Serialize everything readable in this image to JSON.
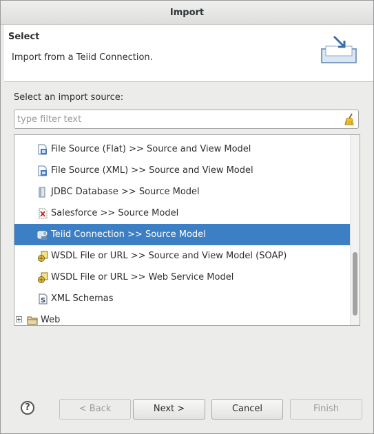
{
  "dialog": {
    "title": "Import"
  },
  "header": {
    "title": "Select",
    "description": "Import from a Teiid Connection."
  },
  "source": {
    "label": "Select an import source:",
    "filter_placeholder": "type filter text",
    "filter_value": ""
  },
  "tree": {
    "items": [
      {
        "label": "File Source (Flat) >> Source and View Model",
        "icon": "file-source-icon",
        "selected": false
      },
      {
        "label": "File Source (XML) >> Source and View Model",
        "icon": "file-source-xml-icon",
        "selected": false
      },
      {
        "label": "JDBC Database >> Source Model",
        "icon": "database-icon",
        "selected": false
      },
      {
        "label": "Salesforce >> Source Model",
        "icon": "salesforce-icon",
        "selected": false
      },
      {
        "label": "Teiid Connection >> Source Model",
        "icon": "teiid-connection-icon",
        "selected": true
      },
      {
        "label": "WSDL File or URL >> Source and View Model (SOAP)",
        "icon": "wsdl-icon",
        "selected": false
      },
      {
        "label": "WSDL File or URL >> Web Service Model",
        "icon": "wsdl-icon",
        "selected": false
      },
      {
        "label": "XML Schemas",
        "icon": "xml-schema-icon",
        "selected": false
      },
      {
        "label": "Web",
        "icon": "folder-icon",
        "selected": false
      }
    ]
  },
  "buttons": {
    "back": "< Back",
    "next": "Next >",
    "cancel": "Cancel",
    "finish": "Finish",
    "help": "?"
  },
  "colors": {
    "selection": "#3d7fc4"
  }
}
